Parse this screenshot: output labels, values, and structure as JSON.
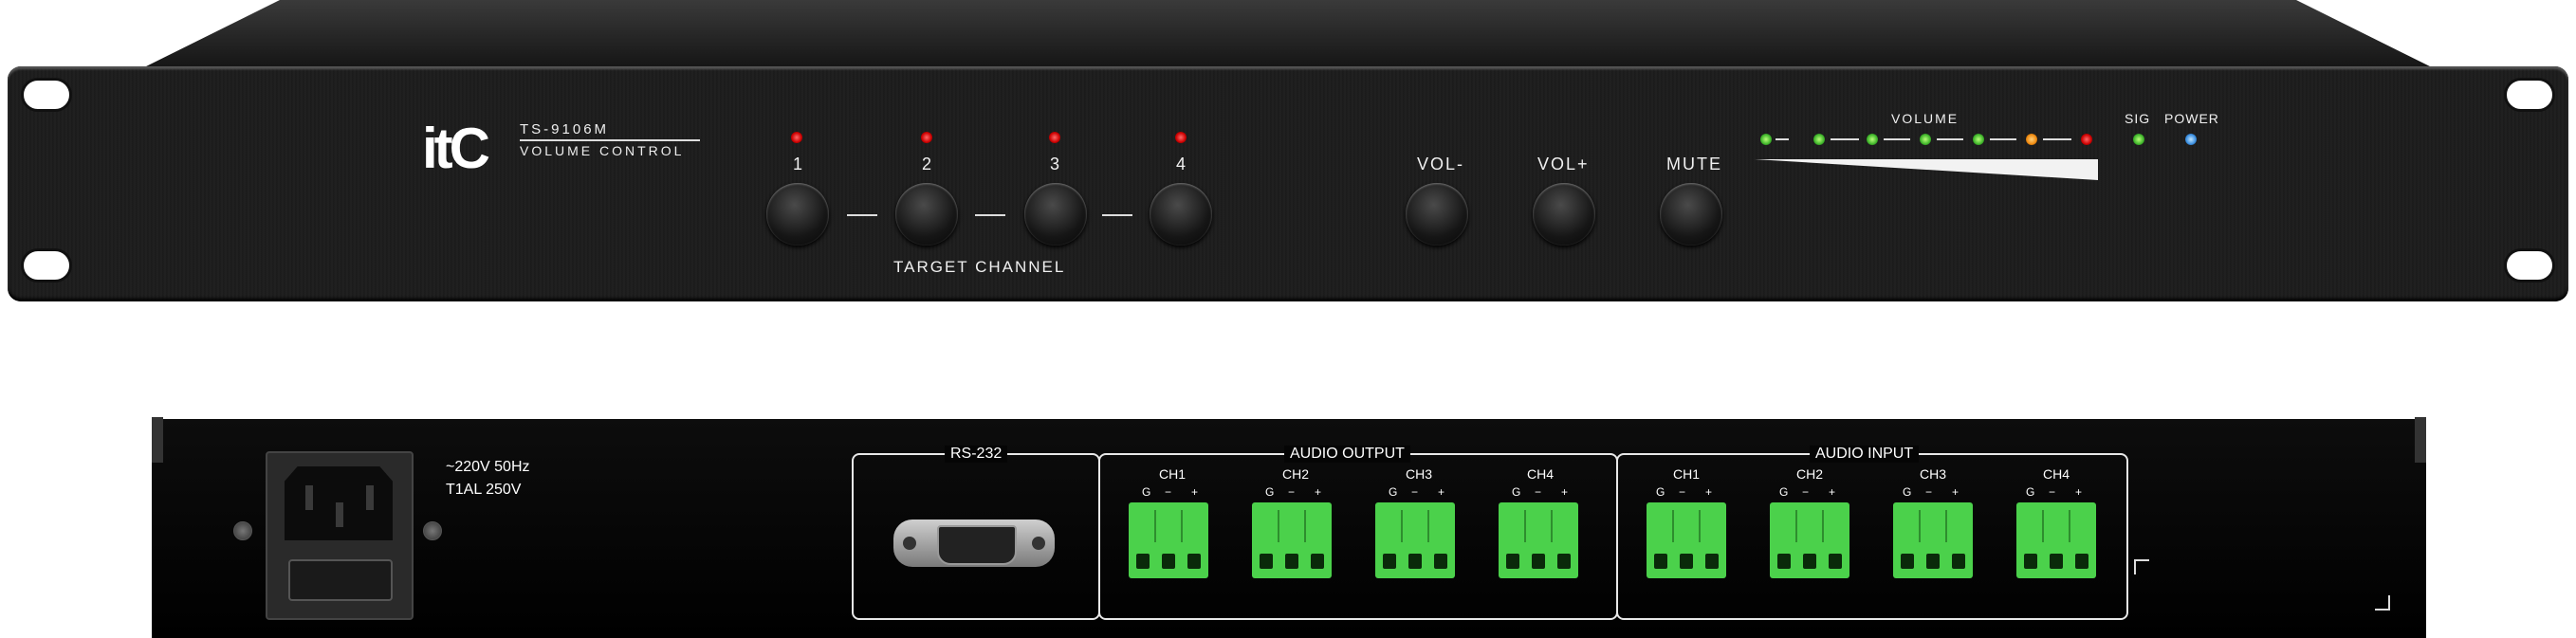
{
  "front": {
    "logo": "itC",
    "model": "TS-9106M",
    "model_subtitle": "VOLUME CONTROL",
    "channels": [
      "1",
      "2",
      "3",
      "4"
    ],
    "target_channel_label": "TARGET CHANNEL",
    "vol_down_label": "VOL-",
    "vol_up_label": "VOL+",
    "mute_label": "MUTE",
    "volume_label": "VOLUME",
    "sig_label": "SIG",
    "power_label": "POWER"
  },
  "rear": {
    "voltage": "~220V  50Hz",
    "fuse": "T1AL  250V",
    "rs232_label": "RS-232",
    "audio_output_label": "AUDIO OUTPUT",
    "audio_input_label": "AUDIO INPUT",
    "output_channels": [
      "CH1",
      "CH2",
      "CH3",
      "CH4"
    ],
    "input_channels": [
      "CH1",
      "CH2",
      "CH3",
      "CH4"
    ],
    "pin_g": "G",
    "pin_minus": "−",
    "pin_plus": "+"
  },
  "colors": {
    "led_red": "#e01010",
    "led_green": "#3fb52b",
    "led_orange": "#f08a10",
    "led_blue": "#3b8fe0",
    "terminal_green": "#4bd14b"
  }
}
